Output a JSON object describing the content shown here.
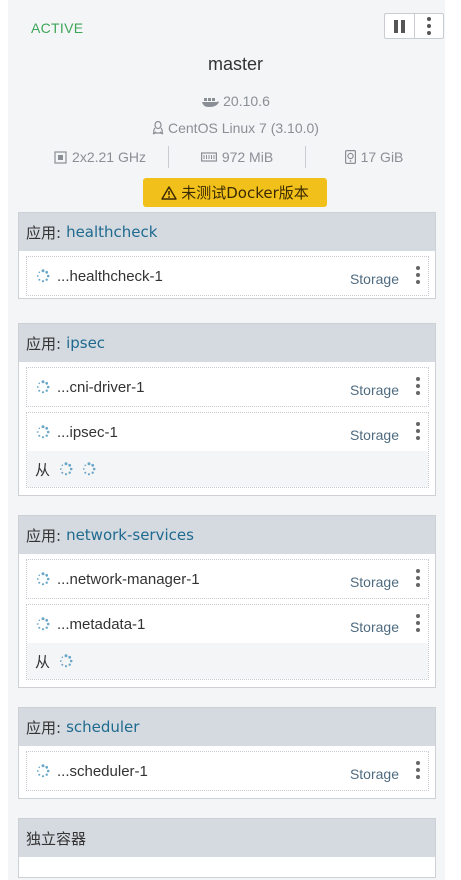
{
  "host": {
    "state": "ACTIVE",
    "name": "master",
    "docker_version": "20.10.6",
    "os": "CentOS Linux 7 (3.10.0)",
    "cpu": "2x2.21 GHz",
    "memory": "972 MiB",
    "storage": "17 GiB",
    "warning": "未测试Docker版本",
    "accent_color": "#3fa65a",
    "warning_color": "#f2c01b"
  },
  "labels": {
    "app_prefix": "应用:",
    "sidekick_label": "从",
    "standalone_title": "独立容器"
  },
  "stacks": [
    {
      "name": "healthcheck",
      "containers": [
        {
          "name": "...healthcheck-1",
          "tag": "Storage"
        }
      ]
    },
    {
      "name": "ipsec",
      "containers": [
        {
          "name": "...cni-driver-1",
          "tag": "Storage"
        },
        {
          "name": "...ipsec-1",
          "tag": "Storage",
          "sidekicks": 2
        }
      ]
    },
    {
      "name": "network-services",
      "containers": [
        {
          "name": "...network-manager-1",
          "tag": "Storage"
        },
        {
          "name": "...metadata-1",
          "tag": "Storage",
          "sidekicks": 1
        }
      ]
    },
    {
      "name": "scheduler",
      "containers": [
        {
          "name": "...scheduler-1",
          "tag": "Storage"
        }
      ]
    }
  ],
  "icons": {
    "pause": "pause-icon",
    "menu": "kebab-menu-icon",
    "docker": "docker-icon",
    "os": "linux-tux-icon",
    "cpu": "cpu-icon",
    "memory": "memory-icon",
    "storage": "disk-icon",
    "warning": "warning-triangle-icon",
    "container_state": "spinner-icon"
  }
}
